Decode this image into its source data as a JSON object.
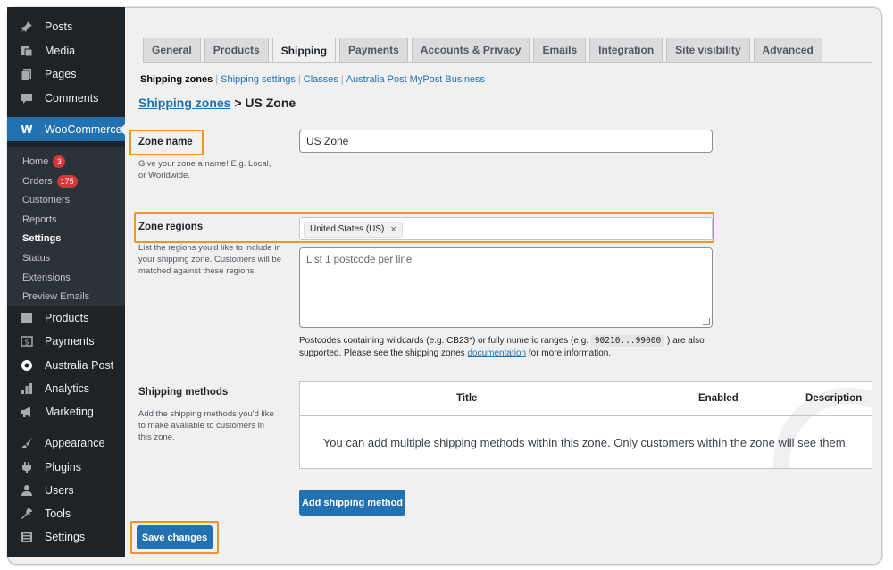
{
  "sidebar": {
    "top_items": [
      {
        "label": "Posts",
        "icon": "pin-icon"
      },
      {
        "label": "Media",
        "icon": "media-icon"
      },
      {
        "label": "Pages",
        "icon": "pages-icon"
      },
      {
        "label": "Comments",
        "icon": "comments-icon"
      }
    ],
    "woocommerce": {
      "label": "WooCommerce",
      "icon_glyph": "W"
    },
    "sub_items": [
      {
        "label": "Home",
        "badge": "3"
      },
      {
        "label": "Orders",
        "badge": "175"
      },
      {
        "label": "Customers"
      },
      {
        "label": "Reports"
      },
      {
        "label": "Settings"
      },
      {
        "label": "Status"
      },
      {
        "label": "Extensions"
      },
      {
        "label": "Preview Emails"
      }
    ],
    "bottom_items": [
      {
        "label": "Products",
        "icon": "products-icon"
      },
      {
        "label": "Payments",
        "icon": "payments-icon"
      },
      {
        "label": "Australia Post",
        "icon": "australia-post-icon"
      },
      {
        "label": "Analytics",
        "icon": "analytics-icon"
      },
      {
        "label": "Marketing",
        "icon": "megaphone-icon"
      },
      {
        "label": "Appearance",
        "icon": "brush-icon"
      },
      {
        "label": "Plugins",
        "icon": "plugin-icon"
      },
      {
        "label": "Users",
        "icon": "users-icon"
      },
      {
        "label": "Tools",
        "icon": "wrench-icon"
      },
      {
        "label": "Settings",
        "icon": "settings-icon"
      }
    ]
  },
  "tabs": [
    "General",
    "Products",
    "Shipping",
    "Payments",
    "Accounts & Privacy",
    "Emails",
    "Integration",
    "Site visibility",
    "Advanced"
  ],
  "active_tab": "Shipping",
  "subnav": {
    "current": "Shipping zones",
    "links": [
      "Shipping settings",
      "Classes",
      "Australia Post MyPost Business"
    ]
  },
  "heading": {
    "link": "Shipping zones",
    "rest": " > US Zone"
  },
  "zone_name": {
    "label": "Zone name",
    "description": "Give your zone a name! E.g. Local, or Worldwide.",
    "value": "US Zone"
  },
  "zone_regions": {
    "label": "Zone regions",
    "description": "List the regions you'd like to include in your shipping zone. Customers will be matched against these regions.",
    "selected_region": "United States (US)",
    "remove_glyph": "×",
    "postcode_placeholder": "List 1 postcode per line",
    "help_1": "Postcodes containing wildcards (e.g. CB23*) or fully numeric ranges (e.g. ",
    "help_code": "90210...99000",
    "help_2": " ) are also supported. Please see the shipping zones ",
    "help_link": "documentation",
    "help_3": " for more information."
  },
  "shipping_methods": {
    "label": "Shipping methods",
    "description": "Add the shipping methods you'd like to make available to customers in this zone.",
    "columns": {
      "title": "Title",
      "enabled": "Enabled",
      "description": "Description"
    },
    "empty_message": "You can add multiple shipping methods within this zone. Only customers within the zone will see them.",
    "add_button": "Add shipping method"
  },
  "save_button": "Save changes",
  "colors": {
    "accent": "#2271b1",
    "highlight": "#f0961e",
    "sidebar_bg": "#1d2327",
    "badge": "#d63638"
  }
}
